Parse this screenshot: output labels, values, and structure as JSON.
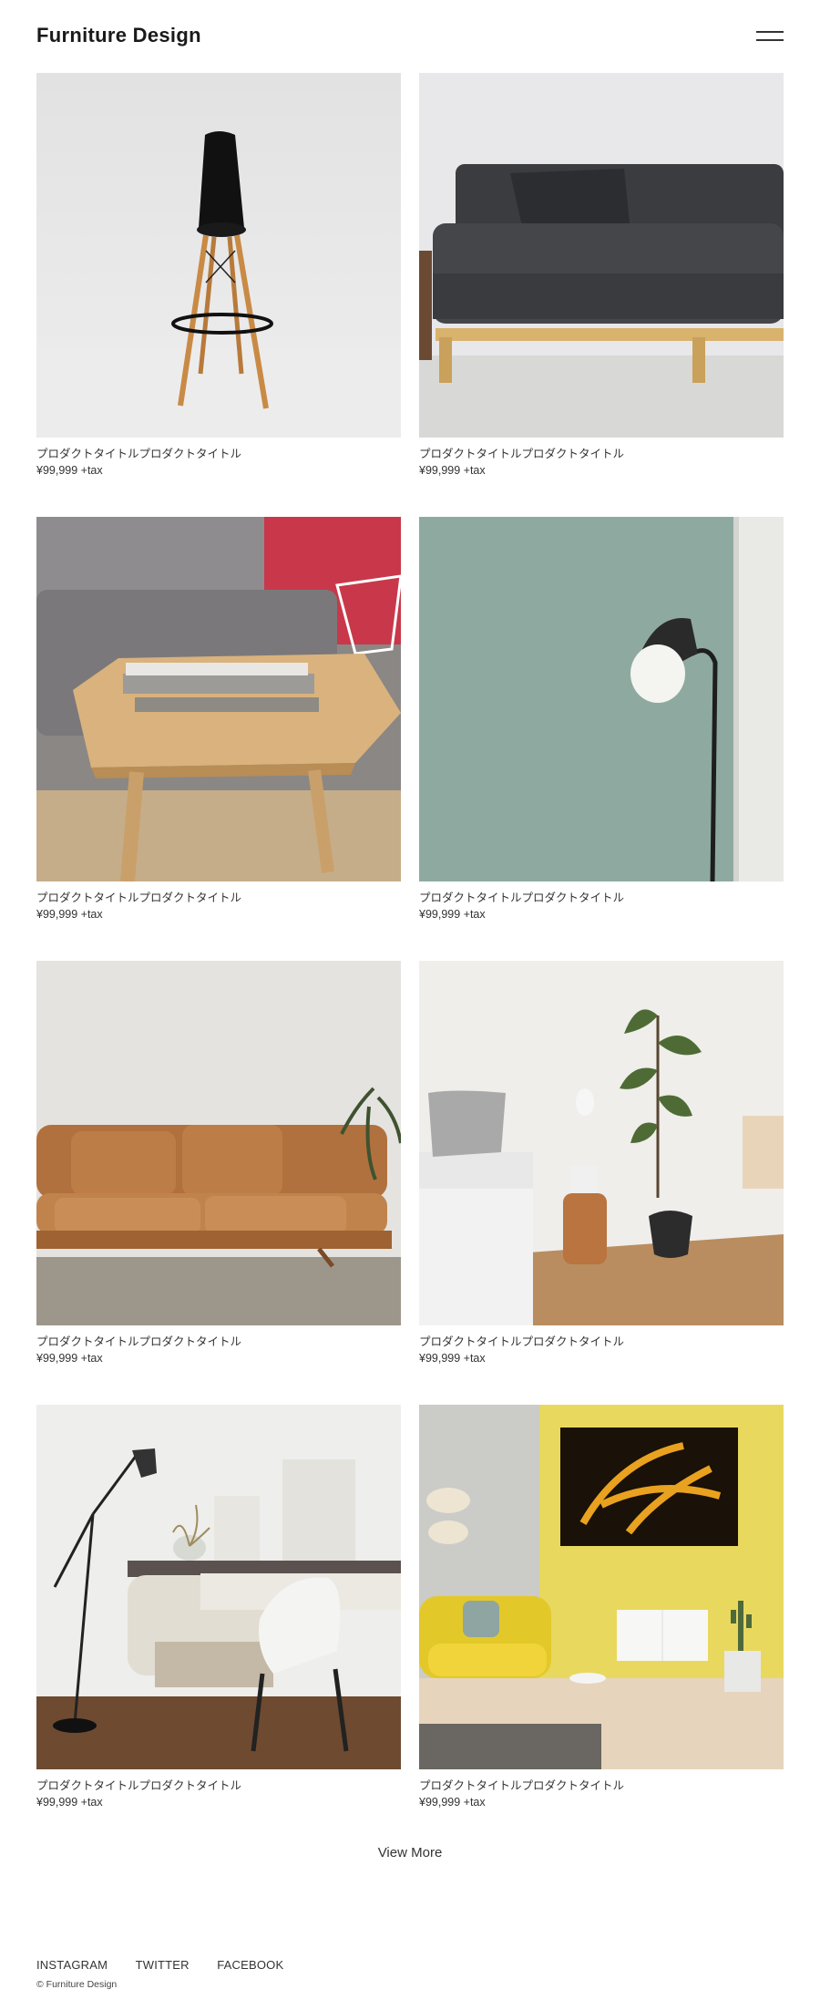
{
  "header": {
    "site_title": "Furniture Design",
    "menu_icon": "hamburger-menu-icon"
  },
  "products": [
    {
      "title": "プロダクトタイトルプロダクトタイトル",
      "price": "¥99,999 +tax",
      "image": "black-bar-stool"
    },
    {
      "title": "プロダクトタイトルプロダクトタイトル",
      "price": "¥99,999 +tax",
      "image": "dark-gray-sofa"
    },
    {
      "title": "プロダクトタイトルプロダクトタイトル",
      "price": "¥99,999 +tax",
      "image": "wooden-coffee-table-with-books"
    },
    {
      "title": "プロダクトタイトルプロダクトタイトル",
      "price": "¥99,999 +tax",
      "image": "black-floor-lamp-on-sage-wall"
    },
    {
      "title": "プロダクトタイトルプロダクトタイトル",
      "price": "¥99,999 +tax",
      "image": "tan-leather-sofa"
    },
    {
      "title": "プロダクトタイトルプロダクトタイトル",
      "price": "¥99,999 +tax",
      "image": "bedroom-with-fiddle-leaf-plant"
    },
    {
      "title": "プロダクトタイトルプロダクトタイトル",
      "price": "¥99,999 +tax",
      "image": "white-desk-and-chair-with-lamp"
    },
    {
      "title": "プロダクトタイトルプロダクトタイトル",
      "price": "¥99,999 +tax",
      "image": "yellow-living-room-with-art"
    }
  ],
  "view_more_label": "View More",
  "footer": {
    "social_links": [
      "INSTAGRAM",
      "TWITTER",
      "FACEBOOK"
    ],
    "copyright": "© Furniture Design"
  }
}
